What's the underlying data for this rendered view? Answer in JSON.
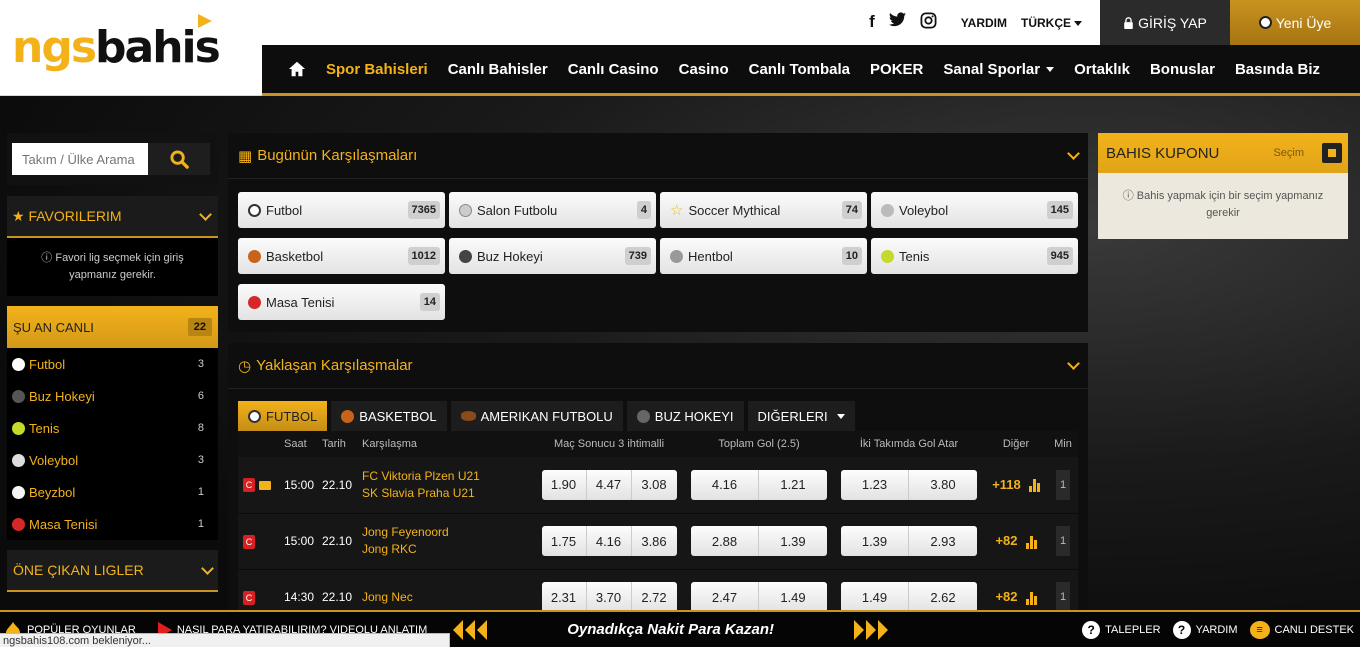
{
  "brand": {
    "part1": "ngs",
    "part2": "bahis"
  },
  "topbar": {
    "social_icons": [
      "facebook-icon",
      "twitter-icon",
      "instagram-icon"
    ],
    "help": "YARDIM",
    "language": "TÜRKÇE",
    "login": "GİRİŞ YAP",
    "register": "Yeni Üye"
  },
  "nav": {
    "items": [
      "Spor Bahisleri",
      "Canlı Bahisler",
      "Canlı Casino",
      "Casino",
      "Canlı Tombala",
      "POKER",
      "Sanal Sporlar",
      "Ortaklık",
      "Bonuslar",
      "Basında Biz"
    ],
    "active": "Spor Bahisleri"
  },
  "sidebar": {
    "search_placeholder": "Takım / Ülke Arama",
    "favorites_title": "FAVORILERIM",
    "favorites_note": "Favori lig seçmek için giriş yapmanız gerekir.",
    "live_title": "ŞU AN CANLI",
    "live_count": "22",
    "live_items": [
      {
        "label": "Futbol",
        "count": "3",
        "color": "#ffffff"
      },
      {
        "label": "Buz Hokeyi",
        "count": "6",
        "color": "#444444"
      },
      {
        "label": "Tenis",
        "count": "8",
        "color": "#c6d92b"
      },
      {
        "label": "Voleybol",
        "count": "3",
        "color": "#dddddd"
      },
      {
        "label": "Beyzbol",
        "count": "1",
        "color": "#f5f5f5"
      },
      {
        "label": "Masa Tenisi",
        "count": "1",
        "color": "#d62828"
      }
    ],
    "featured_title": "ÖNE ÇIKAN LIGLER"
  },
  "today": {
    "title": "Bugünün Karşılaşmaları",
    "sports": [
      {
        "label": "Futbol",
        "count": "7365",
        "color": "#333333"
      },
      {
        "label": "Salon Futbolu",
        "count": "4",
        "color": "#888888"
      },
      {
        "label": "Soccer Mythical",
        "count": "74",
        "color": "#e8c21a"
      },
      {
        "label": "Voleybol",
        "count": "145",
        "color": "#bbbbbb"
      },
      {
        "label": "Basketbol",
        "count": "1012",
        "color": "#c8641a"
      },
      {
        "label": "Buz Hokeyi",
        "count": "739",
        "color": "#444444"
      },
      {
        "label": "Hentbol",
        "count": "10",
        "color": "#999999"
      },
      {
        "label": "Tenis",
        "count": "945",
        "color": "#c6d92b"
      },
      {
        "label": "Masa Tenisi",
        "count": "14",
        "color": "#d62828"
      }
    ]
  },
  "upcoming": {
    "title": "Yaklaşan Karşılaşmalar",
    "tabs": [
      "FUTBOL",
      "BASKETBOL",
      "AMERIKAN FUTBOLU",
      "BUZ HOKEYI",
      "DIĞERLERI"
    ],
    "columns": {
      "time": "Saat",
      "date": "Tarih",
      "match": "Karşılaşma",
      "result": "Maç Sonucu 3 ihtimalli",
      "total": "Toplam Gol (2.5)",
      "btts": "İki Takımda Gol Atar",
      "other": "Diğer",
      "min": "Min"
    },
    "rows": [
      {
        "time": "15:00",
        "date": "22.10",
        "home": "FC Viktoria Plzen U21",
        "away": "SK Slavia Praha U21",
        "odds1x2": [
          "1.90",
          "4.47",
          "3.08"
        ],
        "total": [
          "4.16",
          "1.21"
        ],
        "btts": [
          "1.23",
          "3.80"
        ],
        "more": "+118",
        "min": "1",
        "camera": true
      },
      {
        "time": "15:00",
        "date": "22.10",
        "home": "Jong Feyenoord",
        "away": "Jong RKC",
        "odds1x2": [
          "1.75",
          "4.16",
          "3.86"
        ],
        "total": [
          "2.88",
          "1.39"
        ],
        "btts": [
          "1.39",
          "2.93"
        ],
        "more": "+82",
        "min": "1",
        "camera": false
      },
      {
        "time": "14:30",
        "date": "22.10",
        "home": "Jong Nec",
        "away": "",
        "odds1x2": [
          "2.31",
          "3.70",
          "2.72"
        ],
        "total": [
          "2.47",
          "1.49"
        ],
        "btts": [
          "1.49",
          "2.62"
        ],
        "more": "+82",
        "min": "1",
        "camera": false
      }
    ],
    "live_badge": "C"
  },
  "coupon": {
    "title": "BAHIS KUPONU",
    "selection": "Seçim",
    "note": "Bahis yapmak için bir seçim yapmanız gerekir"
  },
  "bottombar": {
    "popular": "POPÜLER OYUNLAR",
    "how_to": "NASIL PARA YATIRABILIRIM? VIDEOLU ANLATIM",
    "promo": "Oynadıkça Nakit Para Kazan!",
    "requests": "TALEPLER",
    "help": "YARDIM",
    "live_support": "CANLI DESTEK"
  },
  "status_text": "ngsbahis108.com bekleniyor..."
}
